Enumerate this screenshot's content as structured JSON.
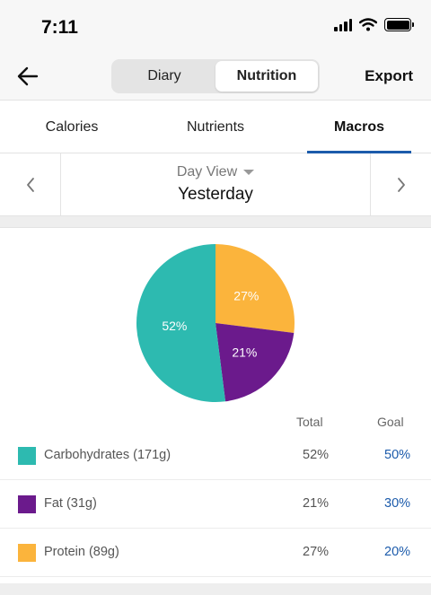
{
  "status_bar": {
    "time": "7:11"
  },
  "header": {
    "segments": [
      {
        "label": "Diary",
        "active": false
      },
      {
        "label": "Nutrition",
        "active": true
      }
    ],
    "export_label": "Export"
  },
  "tabs": [
    {
      "label": "Calories",
      "active": false
    },
    {
      "label": "Nutrients",
      "active": false
    },
    {
      "label": "Macros",
      "active": true
    }
  ],
  "day_selector": {
    "view_label": "Day View",
    "day": "Yesterday"
  },
  "table": {
    "total_header": "Total",
    "goal_header": "Goal",
    "rows": [
      {
        "label": "Carbohydrates (171g)",
        "total": "52%",
        "goal": "50%",
        "color": "#2dbab0"
      },
      {
        "label": "Fat (31g)",
        "total": "21%",
        "goal": "30%",
        "color": "#6b1a8c"
      },
      {
        "label": "Protein (89g)",
        "total": "27%",
        "goal": "20%",
        "color": "#fbb43c"
      }
    ]
  },
  "chart_data": {
    "type": "pie",
    "categories": [
      "Protein",
      "Fat",
      "Carbohydrates"
    ],
    "values": [
      27,
      21,
      52
    ],
    "labels": [
      "27%",
      "21%",
      "52%"
    ],
    "colors": [
      "#fbb43c",
      "#6b1a8c",
      "#2dbab0"
    ],
    "title": ""
  },
  "colors": {
    "accent": "#1c5bab",
    "goal_text": "#1c5bab"
  }
}
